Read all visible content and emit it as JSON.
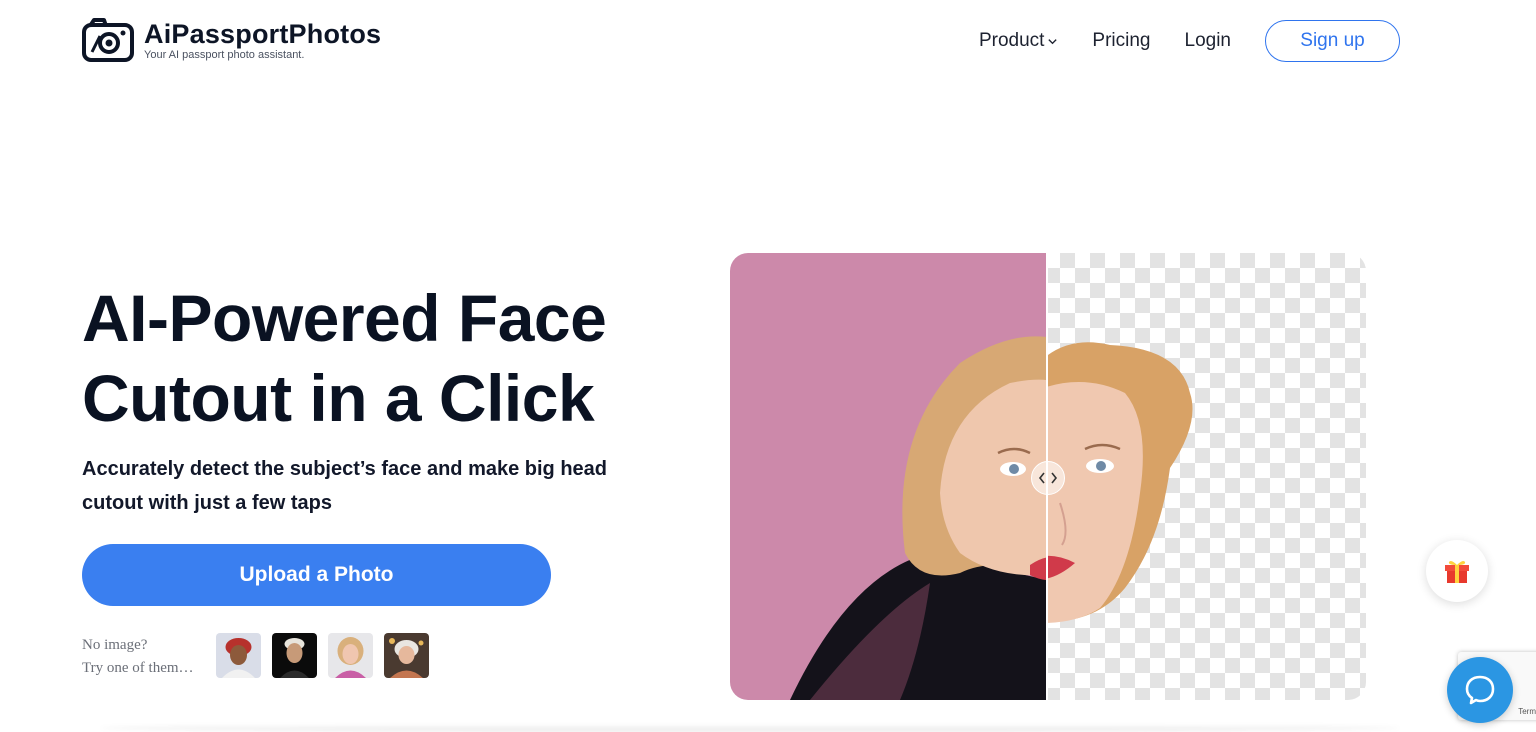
{
  "brand": {
    "name": "AiPassportPhotos",
    "tagline": "Your AI passport photo assistant.",
    "logo_icon": "camera-icon"
  },
  "nav": {
    "product": "Product",
    "pricing": "Pricing",
    "login": "Login",
    "signup": "Sign up"
  },
  "hero": {
    "title_line1": "AI-Powered Face",
    "title_line2": "Cutout in a Click",
    "subtitle": "Accurately detect the subject’s face and make big head cutout with just a few taps",
    "upload_label": "Upload a Photo",
    "samples_line1": "No image?",
    "samples_line2": "Try one of them…"
  },
  "recaptcha": {
    "terms": "Terms"
  },
  "colors": {
    "accent": "#3a7ff0",
    "pink_background": "#cc89aa",
    "chat_blue": "#2b96e3"
  }
}
